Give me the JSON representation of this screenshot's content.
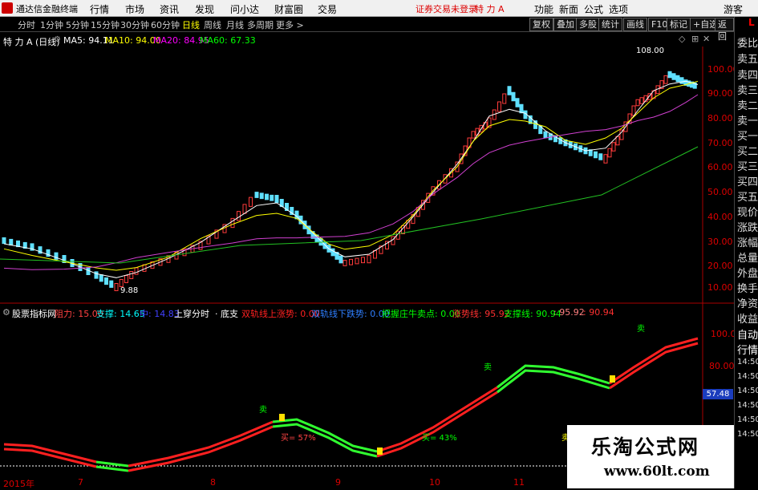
{
  "topbar": {
    "app_name": "通达信金融终端",
    "menus": [
      "行情",
      "市场",
      "资讯",
      "发现",
      "问小达",
      "财富圈",
      "交易"
    ],
    "status": "证券交易未登录",
    "stock_name": "特 力 A",
    "right_menus": [
      "功能",
      "新面",
      "公式",
      "选项"
    ],
    "guest": "游客"
  },
  "toolbar": {
    "periods": [
      "分时",
      "1分钟",
      "5分钟",
      "15分钟",
      "30分钟",
      "60分钟",
      "日线",
      "周线",
      "月线",
      "多周期",
      "更多 >"
    ],
    "active_period": "日线",
    "buttons": [
      "复权",
      "叠加",
      "多股",
      "统计",
      "画线",
      "F10",
      "标记",
      "+自选",
      "返回"
    ]
  },
  "main_chart": {
    "title": "特 力 A (日线)",
    "ma": [
      {
        "label": "MA5: 94.11",
        "color": "#ffffff"
      },
      {
        "label": "MA10: 94.00",
        "color": "#ffff00"
      },
      {
        "label": "MA20: 84.95",
        "color": "#ff00ff"
      },
      {
        "label": "MA60: 67.33",
        "color": "#00ff00"
      }
    ],
    "y_ticks": [
      "100.00",
      "90.00",
      "80.00",
      "70.00",
      "60.00",
      "50.00",
      "40.00",
      "30.00",
      "20.00",
      "10.00"
    ],
    "high_label": "108.00",
    "low_label": "9.88"
  },
  "indicator": {
    "name": "股票指标网",
    "items": [
      {
        "label": "阻力: 15.00",
        "color": "#ff4040"
      },
      {
        "label": "支撑: 14.65",
        "color": "#00ffff"
      },
      {
        "label": "中: 14.83",
        "color": "#4040ff"
      },
      {
        "label": "上穿分时",
        "color": "#ffffff"
      },
      {
        "label": "· 底支",
        "color": "#ffffff"
      },
      {
        "label": "双轨线上涨势: 0.00",
        "color": "#ff2020"
      },
      {
        "label": "双轨线下跌势: 0.00",
        "color": "#2f7fff"
      },
      {
        "label": "把握庄牛卖点: 0.00",
        "color": "#00ff00"
      },
      {
        "label": "涨势线: 95.92",
        "color": "#ff3030"
      },
      {
        "label": "支撑线: 90.94",
        "color": "#00ff00"
      },
      {
        "label": ": 95.92",
        "color": "#ff8080"
      },
      {
        "label": ": 90.94",
        "color": "#ff3030"
      }
    ],
    "y_ticks": [
      "100.0",
      "80.00"
    ],
    "value_badge": "57.48",
    "annotations": [
      "买= 57%",
      "买= 43%",
      "卖",
      "卖",
      "卖",
      "卖"
    ]
  },
  "x_axis": [
    "2015年",
    "7",
    "8",
    "9",
    "10",
    "11"
  ],
  "right_panel": {
    "labels": [
      "委比",
      "卖五",
      "卖四",
      "卖三",
      "卖二",
      "卖一",
      "买一",
      "买二",
      "买三",
      "买四",
      "买五",
      "现价",
      "涨跌",
      "涨幅",
      "总量",
      "外盘",
      "换手",
      "净资",
      "收益",
      "自动",
      "行情"
    ],
    "time_labels": [
      "14:50",
      "14:50",
      "14:50",
      "14:50",
      "14:50",
      "14:50"
    ],
    "corner": "L"
  },
  "watermark": {
    "title": "乐淘公式网",
    "url": "www.60lt.com"
  }
}
